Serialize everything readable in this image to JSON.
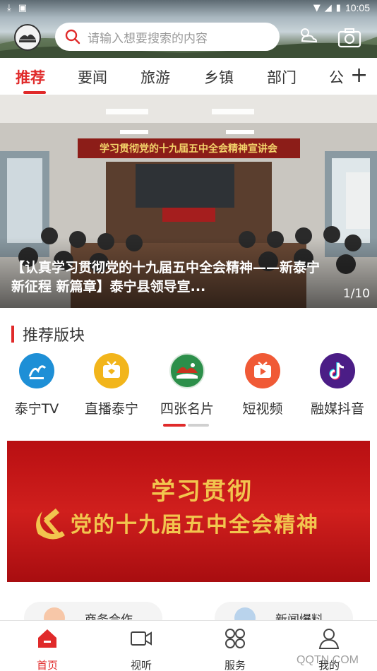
{
  "status_bar": {
    "time": "10:05"
  },
  "search": {
    "placeholder": "请输入想要搜索的内容"
  },
  "tabs": [
    {
      "label": "推荐",
      "active": true
    },
    {
      "label": "要闻"
    },
    {
      "label": "旅游"
    },
    {
      "label": "乡镇"
    },
    {
      "label": "部门"
    },
    {
      "label": "公"
    }
  ],
  "banner": {
    "sign_text": "学习贯彻党的十九届五中全会精神宣讲会",
    "caption": "【认真学习贯彻党的十九届五中全会精神——新泰宁 新征程 新篇章】泰宁县领导宣...",
    "counter": "1/10"
  },
  "section": {
    "title": "推荐版块"
  },
  "grid": [
    {
      "label": "泰宁TV",
      "icon": "taining-tv-icon",
      "color": "#1e8fd6"
    },
    {
      "label": "直播泰宁",
      "icon": "live-tv-icon",
      "color": "#f2b51b"
    },
    {
      "label": "四张名片",
      "icon": "landscape-card-icon",
      "color": "#2c8f4a"
    },
    {
      "label": "短视频",
      "icon": "play-video-icon",
      "color": "#f05a36"
    },
    {
      "label": "融媒抖音",
      "icon": "tiktok-icon",
      "color": "#4b1d86"
    }
  ],
  "promo": {
    "line1": "学习贯彻",
    "line2": "党的十九届五中全会精神"
  },
  "pills": [
    {
      "label": "商务合作"
    },
    {
      "label": "新闻爆料"
    }
  ],
  "bottom_nav": [
    {
      "label": "首页",
      "active": true,
      "icon": "home-icon"
    },
    {
      "label": "视听",
      "icon": "video-camera-icon"
    },
    {
      "label": "服务",
      "icon": "services-grid-icon"
    },
    {
      "label": "我的",
      "icon": "user-icon"
    }
  ],
  "watermark": "QQTN.COM",
  "colors": {
    "accent": "#e02a2a",
    "promo_red": "#c8171a",
    "gold": "#f2c54e"
  }
}
